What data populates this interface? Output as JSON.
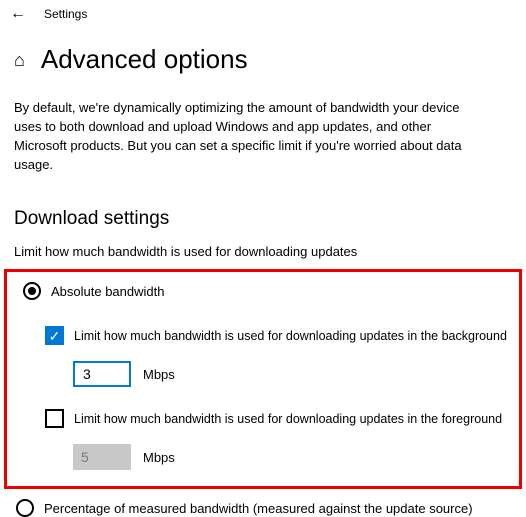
{
  "app_title": "Settings",
  "page_title": "Advanced options",
  "description": "By default, we're dynamically optimizing the amount of bandwidth your device uses to both download and upload Windows and app updates, and other Microsoft products. But you can set a specific limit if you're worried about data usage.",
  "section": {
    "title": "Download settings",
    "subtitle": "Limit how much bandwidth is used for downloading updates"
  },
  "options": {
    "absolute_label": "Absolute bandwidth",
    "bg_checkbox_label": "Limit how much bandwidth is used for downloading updates in the background",
    "bg_value": "3",
    "bg_unit": "Mbps",
    "fg_checkbox_label": "Limit how much bandwidth is used for downloading updates in the foreground",
    "fg_value": "5",
    "fg_unit": "Mbps",
    "percentage_label": "Percentage of measured bandwidth (measured against the update source)"
  }
}
